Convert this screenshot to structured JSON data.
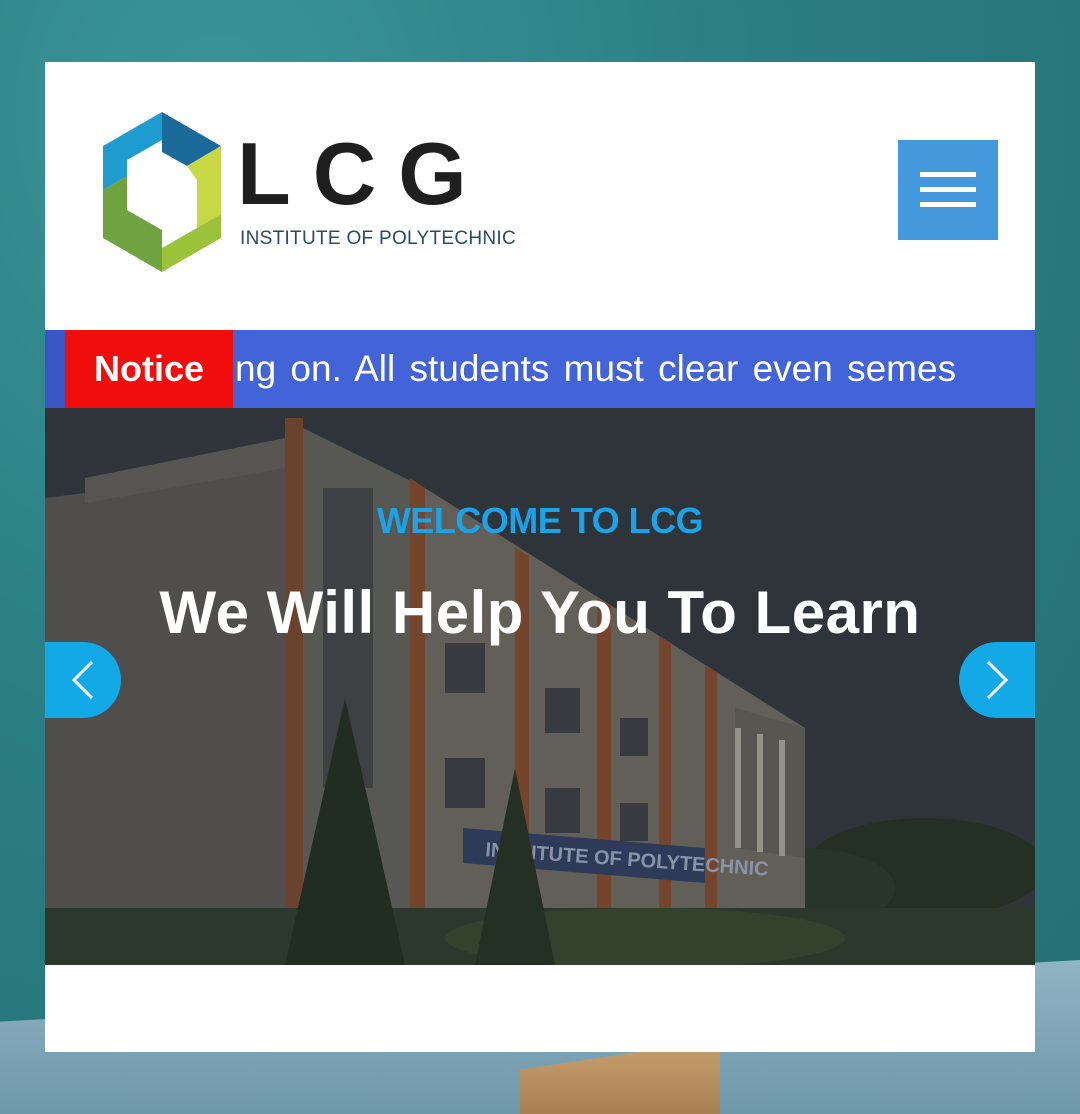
{
  "header": {
    "logo_letters": "LCG",
    "logo_subtitle": "INSTITUTE OF POLYTECHNIC",
    "menu_icon": "hamburger-menu-icon"
  },
  "notice": {
    "label": "Notice",
    "text": "ng on.   All students must clear even semes"
  },
  "hero": {
    "kicker": "WELCOME TO LCG",
    "title": "We Will Help You To Learn",
    "building_sign": "INSTITUTE OF POLYTECHNIC",
    "prev_icon": "chevron-left-icon",
    "next_icon": "chevron-right-icon"
  },
  "colors": {
    "accent": "#4499dd",
    "notice_bar": "#4363d8",
    "notice_label": "#f20d0d",
    "kicker": "#1aa3e8",
    "arrows": "#13a9e6"
  }
}
